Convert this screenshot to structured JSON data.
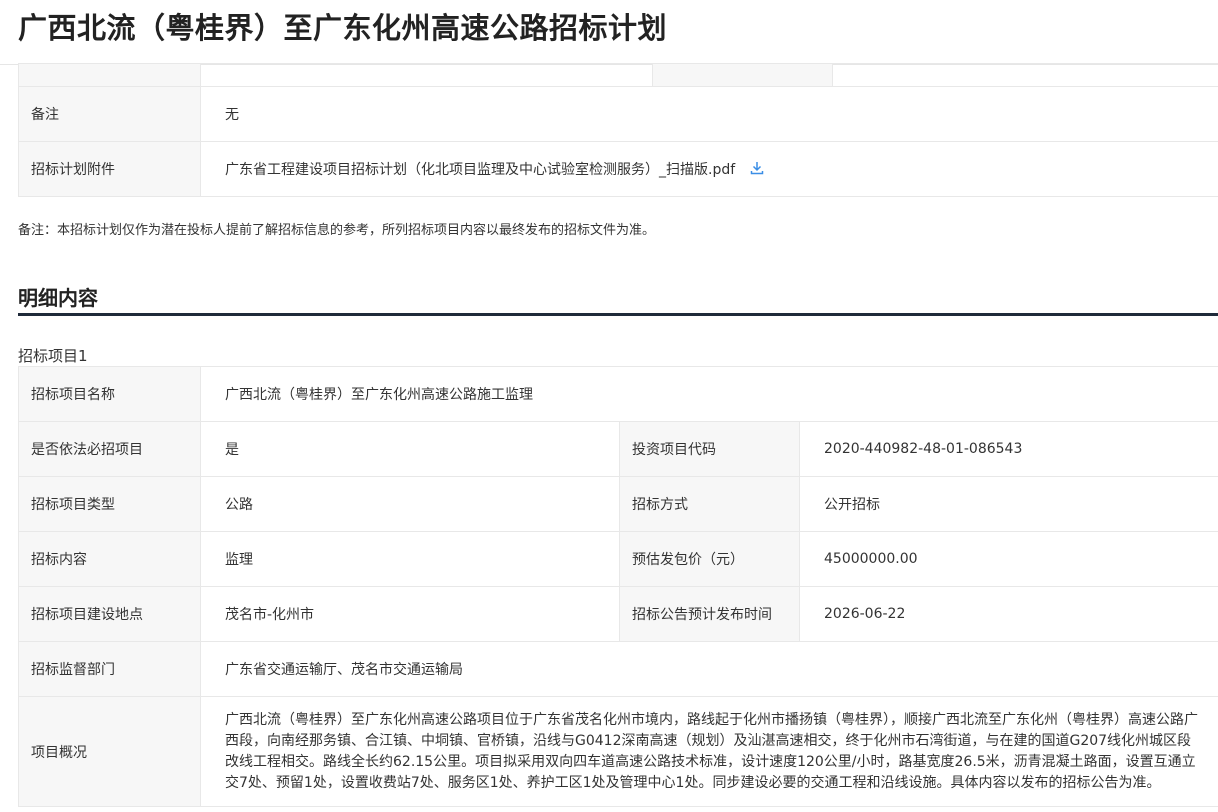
{
  "header": {
    "title": "广西北流（粤桂界）至广东化州高速公路招标计划"
  },
  "plan_info": {
    "remark_label": "备注",
    "remark_value": "无",
    "attachment_label": "招标计划附件",
    "attachment_file": "广东省工程建设项目招标计划（化北项目监理及中心试验室检测服务）_扫描版.pdf"
  },
  "notice": "备注：本招标计划仅作为潜在投标人提前了解招标信息的参考，所列招标项目内容以最终发布的招标文件为准。",
  "details": {
    "section_title": "明细内容",
    "project_heading": "招标项目1",
    "name_label": "招标项目名称",
    "name_value": "广西北流（粤桂界）至广东化州高速公路施工监理",
    "mandatory_label": "是否依法必招项目",
    "mandatory_value": "是",
    "invest_code_label": "投资项目代码",
    "invest_code_value": "2020-440982-48-01-086543",
    "type_label": "招标项目类型",
    "type_value": "公路",
    "method_label": "招标方式",
    "method_value": "公开招标",
    "content_label": "招标内容",
    "content_value": "监理",
    "price_label": "预估发包价（元）",
    "price_value": "45000000.00",
    "location_label": "招标项目建设地点",
    "location_value": "茂名市-化州市",
    "publish_time_label": "招标公告预计发布时间",
    "publish_time_value": "2026-06-22",
    "supervisor_label": "招标监督部门",
    "supervisor_value": "广东省交通运输厅、茂名市交通运输局",
    "overview_label": "项目概况",
    "overview_value": "广西北流（粤桂界）至广东化州高速公路项目位于广东省茂名化州市境内，路线起于化州市播扬镇（粤桂界），顺接广西北流至广东化州（粤桂界）高速公路广西段，向南经那务镇、合江镇、中垌镇、官桥镇，沿线与G0412深南高速（规划）及汕湛高速相交，终于化州市石湾街道，与在建的国道G207线化州城区段改线工程相交。路线全长约62.15公里。项目拟采用双向四车道高速公路技术标准，设计速度120公里/小时，路基宽度26.5米，沥青混凝土路面，设置互通立交7处、预留1处，设置收费站7处、服务区1处、养护工区1处及管理中心1处。同步建设必要的交通工程和沿线设施。具体内容以发布的招标公告为准。"
  },
  "colors": {
    "accent": "#1f2a3a",
    "label_bg": "#f7f7f7",
    "border": "#e8e8e8",
    "link_icon": "#3a8ee6"
  }
}
